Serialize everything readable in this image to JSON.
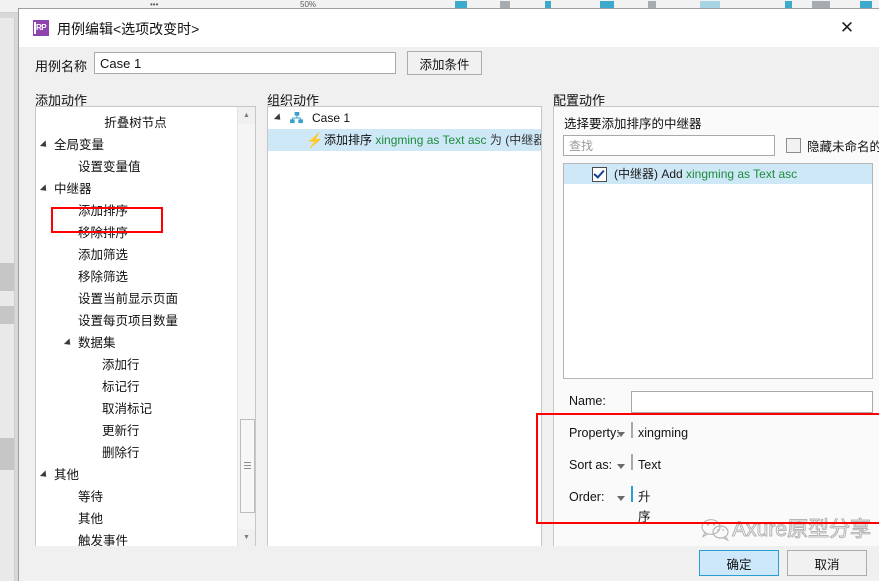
{
  "window": {
    "title": "用例编辑<选项改变时>",
    "icon_label": "RP",
    "close_label": "✕"
  },
  "case": {
    "name_label": "用例名称",
    "name_value": "Case 1",
    "name_placeholder": "",
    "add_condition_label": "添加条件"
  },
  "columns": {
    "add_action": "添加动作",
    "organize_action": "组织动作",
    "configure_action": "配置动作"
  },
  "action_tree": {
    "header": "折叠树节点",
    "items": [
      {
        "label": "全局变量",
        "level": 0,
        "expandable": true,
        "highlight": false
      },
      {
        "label": "设置变量值",
        "level": 1,
        "expandable": false,
        "highlight": false
      },
      {
        "label": "中继器",
        "level": 0,
        "expandable": true,
        "highlight": false
      },
      {
        "label": "添加排序",
        "level": 1,
        "expandable": false,
        "highlight": true
      },
      {
        "label": "移除排序",
        "level": 1,
        "expandable": false,
        "highlight": false
      },
      {
        "label": "添加筛选",
        "level": 1,
        "expandable": false,
        "highlight": false
      },
      {
        "label": "移除筛选",
        "level": 1,
        "expandable": false,
        "highlight": false
      },
      {
        "label": "设置当前显示页面",
        "level": 1,
        "expandable": false,
        "highlight": false
      },
      {
        "label": "设置每页项目数量",
        "level": 1,
        "expandable": false,
        "highlight": false
      },
      {
        "label": "数据集",
        "level": 1,
        "expandable": true,
        "highlight": false
      },
      {
        "label": "添加行",
        "level": 2,
        "expandable": false,
        "highlight": false
      },
      {
        "label": "标记行",
        "level": 2,
        "expandable": false,
        "highlight": false
      },
      {
        "label": "取消标记",
        "level": 2,
        "expandable": false,
        "highlight": false
      },
      {
        "label": "更新行",
        "level": 2,
        "expandable": false,
        "highlight": false
      },
      {
        "label": "删除行",
        "level": 2,
        "expandable": false,
        "highlight": false
      },
      {
        "label": "其他",
        "level": 0,
        "expandable": true,
        "highlight": false
      },
      {
        "label": "等待",
        "level": 1,
        "expandable": false,
        "highlight": false
      },
      {
        "label": "其他",
        "level": 1,
        "expandable": false,
        "highlight": false
      },
      {
        "label": "触发事件",
        "level": 1,
        "expandable": false,
        "highlight": false
      }
    ]
  },
  "organize_tree": {
    "case_label": "Case 1",
    "action_prefix": "添加排序",
    "action_expr": "xingming as Text asc",
    "action_suffix": "为 (中继器)"
  },
  "configure": {
    "section_title": "选择要添加排序的中继器",
    "search_placeholder": "查找",
    "search_value": "",
    "hide_unnamed_label": "隐藏未命名的元件",
    "hide_unnamed_checked": false,
    "list_items": [
      {
        "checked": true,
        "prefix": "(中继器) Add ",
        "expr": "xingming as Text asc"
      }
    ],
    "fields": [
      {
        "label": "Name:",
        "type": "text",
        "value": "",
        "focused": false
      },
      {
        "label": "Property:",
        "type": "combo",
        "value": "xingming",
        "focused": false
      },
      {
        "label": "Sort as:",
        "type": "combo",
        "value": "Text",
        "focused": false
      },
      {
        "label": "Order:",
        "type": "combo",
        "value": "升序",
        "focused": true
      }
    ]
  },
  "footer": {
    "ok_label": "确定",
    "cancel_label": "取消"
  },
  "watermark": {
    "text": "Axure原型分享",
    "icon": "wechat-icon"
  },
  "colors": {
    "accent_blue": "#2a9fd6",
    "selection_blue": "#cfe8f7",
    "highlight_red": "#ff0000",
    "expr_green": "#1e8b3b",
    "brand_purple": "#8d44ad"
  }
}
